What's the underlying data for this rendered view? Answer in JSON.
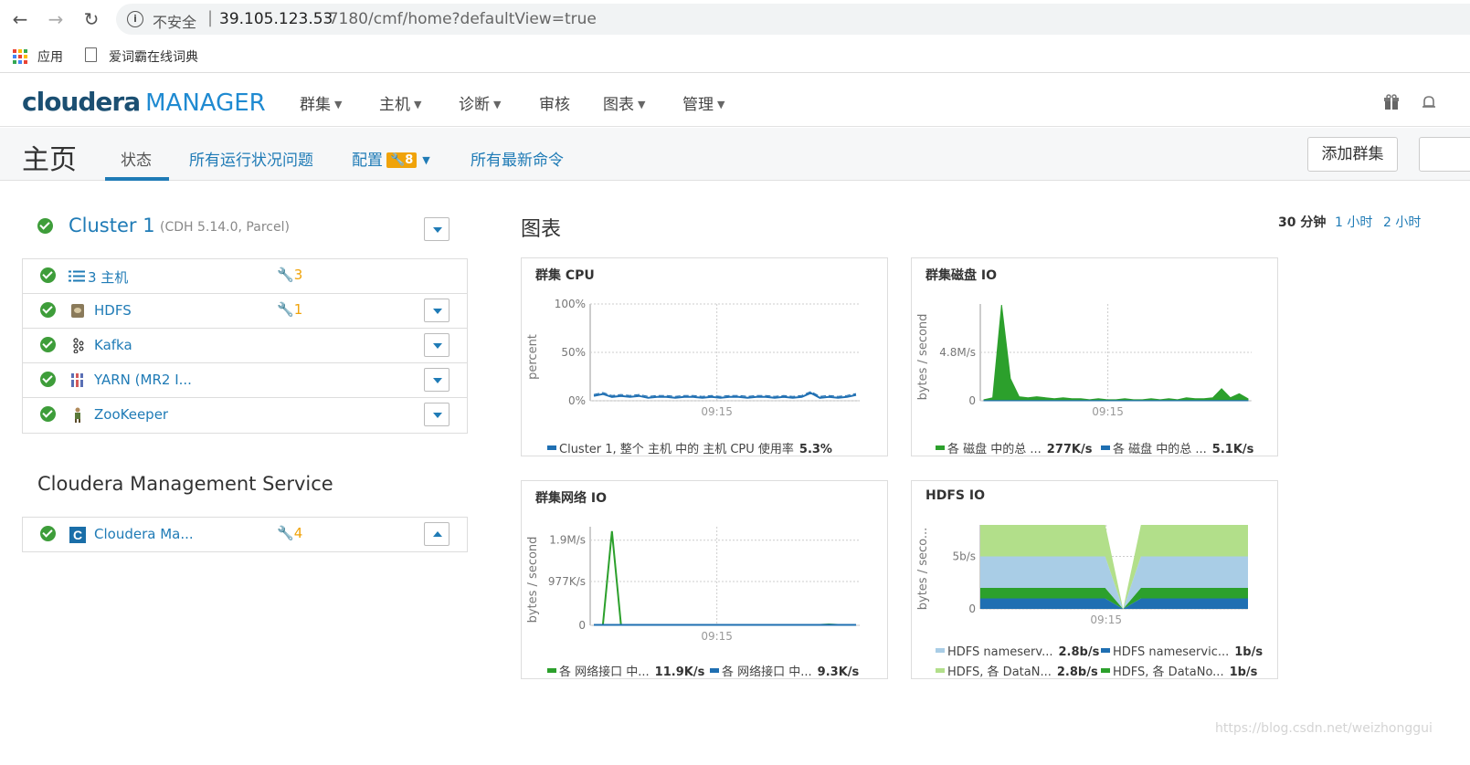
{
  "browser": {
    "security_label": "不安全",
    "url_host": "39.105.123.53",
    "url_path": ":7180/cmf/home?defaultView=true",
    "bookmarks": [
      "应用",
      "爱词霸在线词典"
    ]
  },
  "header": {
    "logo_main": "cloudera",
    "logo_sub": "MANAGER",
    "nav": [
      "群集",
      "主机",
      "诊断",
      "审核",
      "图表",
      "管理"
    ]
  },
  "subheader": {
    "title": "主页",
    "tabs": [
      "状态",
      "所有运行状况问题",
      "配置",
      "所有最新命令"
    ],
    "config_badge": "8",
    "add_cluster": "添加群集"
  },
  "cluster": {
    "name": "Cluster 1",
    "version": "(CDH 5.14.0, Parcel)",
    "services": [
      {
        "name": "3 主机",
        "icon": "hosts-list-icon",
        "config_issues": "3"
      },
      {
        "name": "HDFS",
        "icon": "hdfs-icon",
        "config_issues": "1"
      },
      {
        "name": "Kafka",
        "icon": "kafka-icon",
        "config_issues": ""
      },
      {
        "name": "YARN (MR2 I...",
        "icon": "yarn-icon",
        "config_issues": ""
      },
      {
        "name": "ZooKeeper",
        "icon": "zookeeper-icon",
        "config_issues": ""
      }
    ]
  },
  "mgmt": {
    "title": "Cloudera Management Service",
    "service": {
      "name": "Cloudera Ma...",
      "config_issues": "4"
    }
  },
  "charts_section": {
    "title": "图表",
    "ranges": [
      "30 分钟",
      "1 小时",
      "2 小时"
    ]
  },
  "colors": {
    "accent": "#1f7bb6",
    "ok_green": "#3e9d3a",
    "warn": "#f0a30a"
  },
  "chart_data": [
    {
      "type": "line",
      "title": "群集 CPU",
      "ylabel": "percent",
      "yticks": [
        "100%",
        "50%",
        "0%"
      ],
      "xtick": "09:15",
      "ylim": [
        0,
        100
      ],
      "series": [
        {
          "name": "Cluster 1, 整个 主机 中的 主机 CPU 使用率",
          "value_label": "5.3%",
          "color": "#1f6fb2",
          "values": [
            5,
            7,
            4,
            5,
            4,
            5,
            3,
            4,
            4,
            3,
            4,
            4,
            3,
            4,
            3,
            4,
            4,
            3,
            4,
            4,
            3,
            4,
            3,
            4,
            8,
            3,
            4,
            3,
            4,
            6
          ]
        }
      ]
    },
    {
      "type": "area",
      "title": "群集磁盘 IO",
      "ylabel": "bytes / second",
      "yticks": [
        "4.8M/s",
        "0"
      ],
      "xtick": "09:15",
      "series": [
        {
          "name": "各 磁盘 中的总 ...",
          "value_label": "277K/s",
          "color": "#2ca02c",
          "values": [
            0.1,
            0.3,
            9.5,
            2.2,
            0.4,
            0.3,
            0.4,
            0.3,
            0.2,
            0.3,
            0.2,
            0.2,
            0.1,
            0.2,
            0.1,
            0.1,
            0.2,
            0.1,
            0.1,
            0.2,
            0.1,
            0.2,
            0.1,
            0.3,
            0.2,
            0.2,
            0.3,
            1.2,
            0.3,
            0.7,
            0.2
          ]
        },
        {
          "name": "各 磁盘 中的总 ...",
          "value_label": "5.1K/s",
          "color": "#1f6fb2",
          "values": [
            0.02,
            0.02,
            0.03,
            0.02,
            0.02,
            0.02,
            0.02,
            0.02,
            0.02,
            0.02,
            0.02,
            0.02,
            0.02,
            0.02,
            0.02,
            0.02,
            0.02,
            0.02,
            0.02,
            0.02,
            0.02,
            0.02,
            0.02,
            0.02,
            0.02,
            0.02,
            0.02,
            0.02,
            0.02,
            0.02,
            0.02
          ]
        }
      ]
    },
    {
      "type": "line",
      "title": "群集网络 IO",
      "ylabel": "bytes / second",
      "yticks": [
        "1.9M/s",
        "977K/s",
        "0"
      ],
      "xtick": "09:15",
      "series": [
        {
          "name": "各 网络接口 中...",
          "value_label": "11.9K/s",
          "color": "#2ca02c",
          "values": [
            0.01,
            0.01,
            2.1,
            0.01,
            0.01,
            0.01,
            0.01,
            0.01,
            0.01,
            0.01,
            0.01,
            0.01,
            0.01,
            0.01,
            0.01,
            0.01,
            0.01,
            0.01,
            0.01,
            0.01,
            0.01,
            0.01,
            0.01,
            0.01,
            0.01,
            0.01,
            0.02,
            0.01,
            0.01,
            0.01
          ]
        },
        {
          "name": "各 网络接口 中...",
          "value_label": "9.3K/s",
          "color": "#1f6fb2",
          "values": [
            0.01,
            0.01,
            0.01,
            0.01,
            0.01,
            0.01,
            0.01,
            0.01,
            0.01,
            0.01,
            0.01,
            0.01,
            0.01,
            0.01,
            0.01,
            0.01,
            0.01,
            0.01,
            0.01,
            0.01,
            0.01,
            0.01,
            0.01,
            0.01,
            0.01,
            0.01,
            0.01,
            0.01,
            0.01,
            0.01
          ]
        }
      ]
    },
    {
      "type": "area",
      "title": "HDFS IO",
      "ylabel": "bytes / seco...",
      "yticks": [
        "5b/s",
        "0"
      ],
      "xtick": "09:15",
      "stacked": true,
      "series": [
        {
          "name": "HDFS, 各 DataNo...",
          "value_label": "1b/s",
          "color": "#1f6fb2",
          "values": [
            1,
            1,
            1,
            1,
            1,
            1,
            1,
            1,
            0,
            1,
            1,
            1,
            1,
            1,
            1,
            1
          ]
        },
        {
          "name": "HDFS, 各 DataN...",
          "value_label": "2.8b/s",
          "color": "#2ca02c",
          "values": [
            1,
            1,
            1,
            1,
            1,
            1,
            1,
            1,
            0,
            1,
            1,
            1,
            1,
            1,
            1,
            1
          ]
        },
        {
          "name": "HDFS nameserv...",
          "value_label": "2.8b/s",
          "color": "#a9cde6",
          "values": [
            3,
            3,
            3,
            3,
            3,
            3,
            3,
            3,
            0,
            3,
            3,
            3,
            3,
            3,
            3,
            3
          ]
        },
        {
          "name": "HDFS nameservic...",
          "value_label": "1b/s",
          "color": "#b2df8a",
          "values": [
            3,
            3,
            3,
            3,
            3,
            3,
            3,
            3,
            0,
            3,
            3,
            3,
            3,
            3,
            3,
            3
          ]
        }
      ]
    }
  ]
}
